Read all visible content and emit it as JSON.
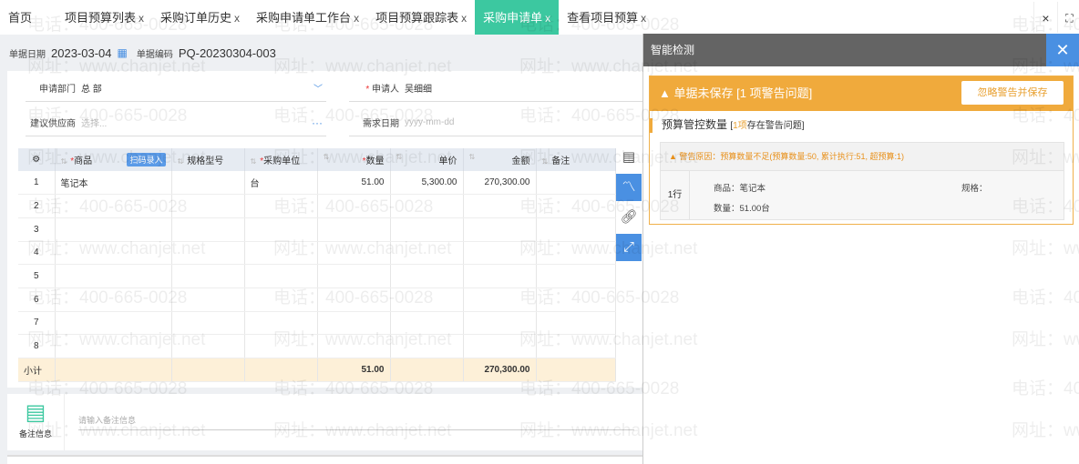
{
  "tabs": [
    {
      "label": "首页",
      "closable": false
    },
    {
      "label": "项目预算列表",
      "closable": true
    },
    {
      "label": "采购订单历史",
      "closable": true
    },
    {
      "label": "采购申请单工作台",
      "closable": true
    },
    {
      "label": "项目预算跟踪表",
      "closable": true
    },
    {
      "label": "采购申请单",
      "closable": true,
      "active": true
    },
    {
      "label": "查看项目预算",
      "closable": true
    }
  ],
  "close_glyph": "×",
  "header": {
    "date_label": "单据日期",
    "date_value": "2023-03-04",
    "code_label": "单据编码",
    "code_value": "PQ-20230304-003"
  },
  "form": {
    "dept_label": "申请部门",
    "dept_value": "总 部",
    "applicant_label": "申请人",
    "applicant_value": "吴细细",
    "supplier_label": "建议供应商",
    "supplier_placeholder": "选择...",
    "need_date_label": "需求日期",
    "need_date_placeholder": "yyyy-mm-dd"
  },
  "table": {
    "headers": [
      "商品",
      "扫码录入",
      "规格型号",
      "采购单位",
      "数量",
      "单价",
      "金额",
      "备注"
    ],
    "rows": [
      {
        "no": "1",
        "item": "笔记本",
        "spec": "",
        "unit": "台",
        "qty": "51.00",
        "price": "5,300.00",
        "amount": "270,300.00",
        "note": ""
      },
      {
        "no": "2"
      },
      {
        "no": "3"
      },
      {
        "no": "4"
      },
      {
        "no": "5"
      },
      {
        "no": "6"
      },
      {
        "no": "7"
      },
      {
        "no": "8"
      }
    ],
    "subtotal": {
      "label": "小计",
      "qty": "51.00",
      "amount": "270,300.00"
    }
  },
  "remark": {
    "label": "备注信息",
    "placeholder": "请输入备注信息"
  },
  "panel": {
    "title": "智能检测",
    "banner": "单据未保存 [1 项警告问题]",
    "ignore_button": "忽略警告并保存",
    "section_title": "预算管控数量",
    "section_count_prefix": "[",
    "section_count": "1项",
    "section_count_suffix": "存在警告问题]",
    "reason": "警告原因：预算数量不足(预算数量:50, 累计执行:51, 超预算:1)",
    "row_label": "1行",
    "item_label": "商品：笔记本",
    "spec_label": "规格：",
    "qty_label": "数量：51.00台"
  },
  "watermark": {
    "phone": "电话：400-665-0028",
    "site": "网址：www.chanjet.net"
  },
  "colors": {
    "accent": "#3cc8a0",
    "warning": "#f0aa3c",
    "blue": "#4a90e2"
  }
}
